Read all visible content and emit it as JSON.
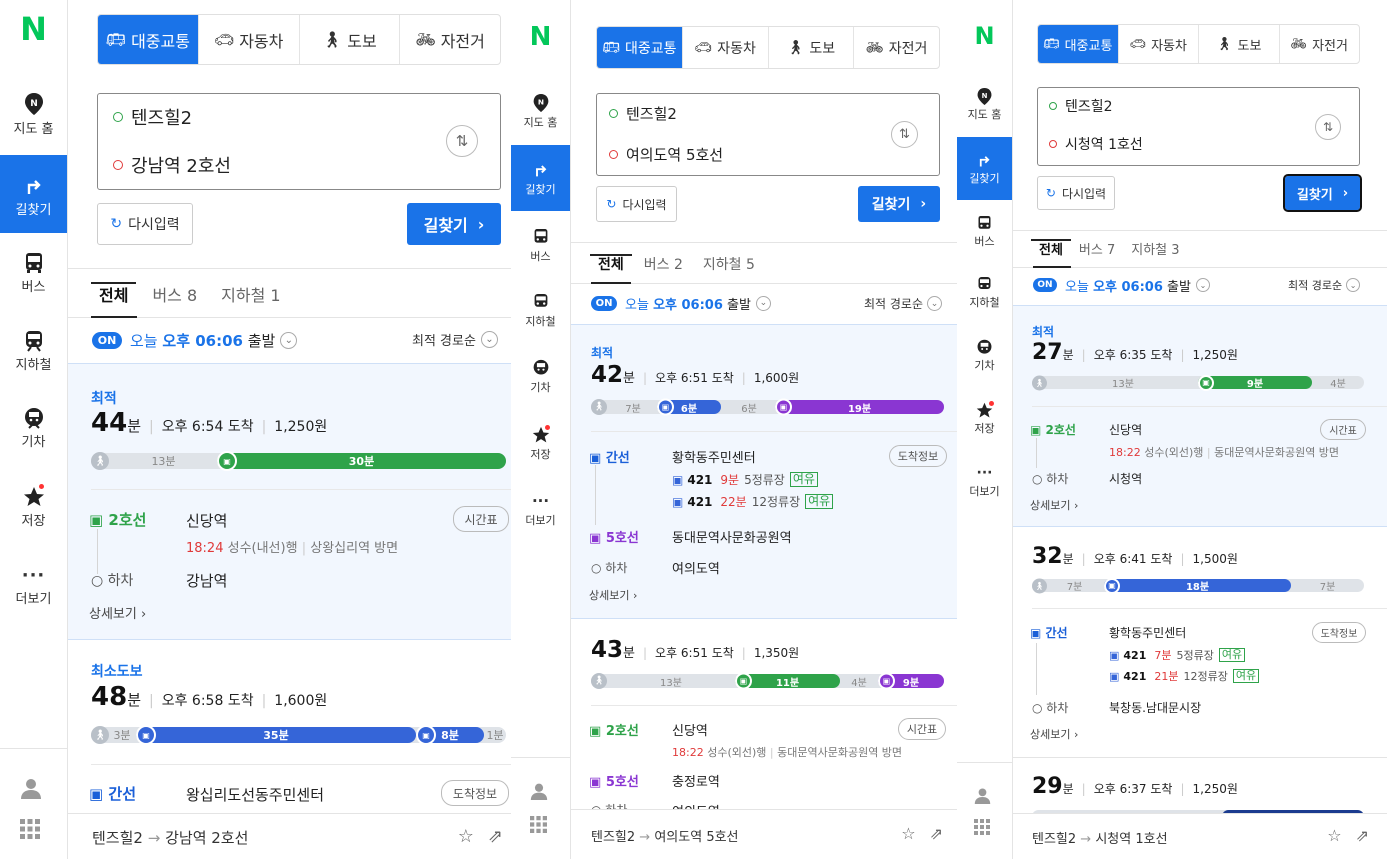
{
  "nav": {
    "logo": "N",
    "items": [
      {
        "label": "지도 홈",
        "icon": "map-pin-icon"
      },
      {
        "label": "길찾기",
        "icon": "turn-right-icon"
      },
      {
        "label": "버스",
        "icon": "bus-icon"
      },
      {
        "label": "지하철",
        "icon": "subway-icon"
      },
      {
        "label": "기차",
        "icon": "train-icon"
      },
      {
        "label": "저장",
        "icon": "star-icon"
      },
      {
        "label": "더보기",
        "icon": "more-icon"
      }
    ]
  },
  "modes": [
    "대중교통",
    "자동차",
    "도보",
    "자전거"
  ],
  "common": {
    "reset": "다시입력",
    "find": "길찾기",
    "tab_all": "전체",
    "on": "ON",
    "today": "오늘",
    "time": "오후 06:06",
    "depart": "출발",
    "sort": "최적 경로순",
    "detail": "상세보기",
    "timetable": "시간표",
    "arrival_info": "도착정보",
    "vacancy": "여유",
    "alight": "하차"
  },
  "panels": [
    {
      "origin": "텐즈힐2",
      "destination": "강남역 2호선",
      "tab_bus": "버스 8",
      "tab_subway": "지하철 1",
      "routes": [
        {
          "badge": "최적",
          "minutes": "44",
          "unit": "분",
          "arrive": "오후 6:54 도착",
          "fare": "1,250원",
          "walk1": "13분",
          "ride1": "30분",
          "leg_name": "2호선",
          "board": "신당역",
          "dep_time": "18:24",
          "dir1": "성수(내선)행",
          "dir2": "상왕십리역 방면",
          "alight_stn": "강남역"
        },
        {
          "badge": "최소도보",
          "minutes": "48",
          "unit": "분",
          "arrive": "오후 6:58 도착",
          "fare": "1,600원",
          "walk1": "3분",
          "ride1": "35분",
          "ride2": "8분",
          "walk2": "1분",
          "leg_name": "간선",
          "board": "왕십리도선동주민센터"
        }
      ],
      "footer": {
        "from": "텐즈힐2",
        "to": "강남역 2호선"
      }
    },
    {
      "origin": "텐즈힐2",
      "destination": "여의도역 5호선",
      "tab_bus": "버스 2",
      "tab_subway": "지하철 5",
      "routes": [
        {
          "badge": "최적",
          "minutes": "42",
          "unit": "분",
          "arrive": "오후 6:51 도착",
          "fare": "1,600원",
          "walk1": "7분",
          "ride1": "6분",
          "walk2": "6분",
          "ride2": "19분",
          "leg_name": "간선",
          "board": "황학동주민센터",
          "bus1": {
            "no": "421",
            "eta": "9분",
            "stops": "5정류장"
          },
          "bus2": {
            "no": "421",
            "eta": "22분",
            "stops": "12정류장"
          },
          "leg2_name": "5호선",
          "leg2_stn": "동대문역사문화공원역",
          "alight_stn": "여의도역"
        },
        {
          "minutes": "43",
          "unit": "분",
          "arrive": "오후 6:51 도착",
          "fare": "1,350원",
          "walk1": "13분",
          "ride1": "11분",
          "walk2": "4분",
          "ride2": "9분",
          "leg_name": "2호선",
          "board": "신당역",
          "dep_time": "18:22",
          "dir1": "성수(외선)행",
          "dir2": "동대문역사문화공원역 방면",
          "leg2_name": "5호선",
          "leg2_stn": "충정로역",
          "alight_stn": "여의도역"
        }
      ],
      "footer": {
        "from": "텐즈힐2",
        "to": "여의도역 5호선"
      }
    },
    {
      "origin": "텐즈힐2",
      "destination": "시청역 1호선",
      "tab_bus": "버스 7",
      "tab_subway": "지하철 3",
      "routes": [
        {
          "badge": "최적",
          "minutes": "27",
          "unit": "분",
          "arrive": "오후 6:35 도착",
          "fare": "1,250원",
          "walk1": "13분",
          "ride1": "9분",
          "walk2": "4분",
          "leg_name": "2호선",
          "board": "신당역",
          "dep_time": "18:22",
          "dir1": "성수(외선)행",
          "dir2": "동대문역사문화공원역 방면",
          "alight_stn": "시청역"
        },
        {
          "minutes": "32",
          "unit": "분",
          "arrive": "오후 6:41 도착",
          "fare": "1,500원",
          "walk1": "7분",
          "ride1": "18분",
          "walk2": "7분",
          "leg_name": "간선",
          "board": "황학동주민센터",
          "bus1": {
            "no": "421",
            "eta": "7분",
            "stops": "5정류장"
          },
          "bus2": {
            "no": "421",
            "eta": "21분",
            "stops": "12정류장"
          },
          "alight_stn": "북창동.남대문시장"
        },
        {
          "minutes": "29",
          "unit": "분",
          "arrive": "오후 6:37 도착",
          "fare": "1,250원"
        }
      ],
      "footer": {
        "from": "텐즈힐2",
        "to": "시청역 1호선"
      }
    }
  ],
  "colors": {
    "accent": "#1a73e8",
    "naver_green": "#03c75a",
    "line2_green": "#2fa34a",
    "bus_blue": "#1a5fd8",
    "line5_purple": "#8a36d2",
    "line1_navy": "#1b3b8f",
    "highlight_bg": "#f2f7fe",
    "walk_bar": "#dfe3e8"
  }
}
